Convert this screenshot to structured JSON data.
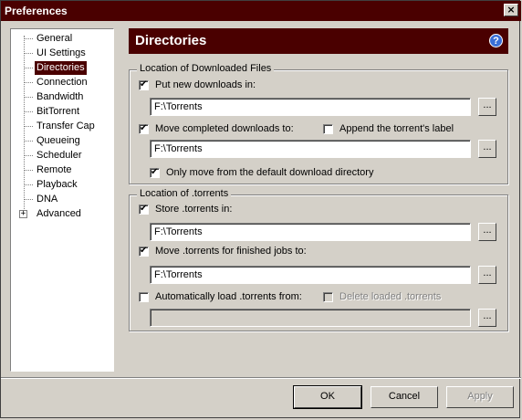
{
  "window": {
    "title": "Preferences",
    "close_label": "×"
  },
  "tree": {
    "items": [
      {
        "label": "General"
      },
      {
        "label": "UI Settings"
      },
      {
        "label": "Directories"
      },
      {
        "label": "Connection"
      },
      {
        "label": "Bandwidth"
      },
      {
        "label": "BitTorrent"
      },
      {
        "label": "Transfer Cap"
      },
      {
        "label": "Queueing"
      },
      {
        "label": "Scheduler"
      },
      {
        "label": "Remote"
      },
      {
        "label": "Playback"
      },
      {
        "label": "DNA"
      },
      {
        "label": "Advanced"
      }
    ],
    "selected": "Directories",
    "expander": "+"
  },
  "header": {
    "title": "Directories",
    "help": "?"
  },
  "downloaded": {
    "title": "Location of Downloaded Files",
    "put_new": {
      "label": "Put new downloads in:",
      "checked": true,
      "path": "F:\\Torrents"
    },
    "move_completed": {
      "label": "Move completed downloads to:",
      "checked": true,
      "path": "F:\\Torrents"
    },
    "append_label": {
      "label": "Append the torrent's label",
      "checked": false
    },
    "only_move": {
      "label": "Only move from the default download directory",
      "checked": true
    }
  },
  "torrents": {
    "title": "Location of .torrents",
    "store": {
      "label": "Store .torrents in:",
      "checked": true,
      "path": "F:\\Torrents"
    },
    "move_finished": {
      "label": "Move .torrents for finished jobs to:",
      "checked": true,
      "path": "F:\\Torrents"
    },
    "auto_load": {
      "label": "Automatically load .torrents from:",
      "checked": false,
      "path": ""
    },
    "delete_loaded": {
      "label": "Delete loaded .torrents",
      "checked": false,
      "disabled": true
    }
  },
  "browse_label": "...",
  "buttons": {
    "ok": "OK",
    "cancel": "Cancel",
    "apply": "Apply"
  }
}
